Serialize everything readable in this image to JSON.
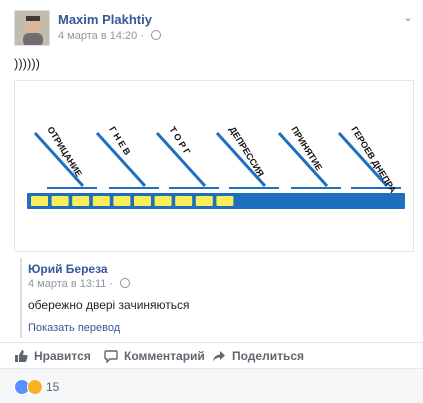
{
  "post": {
    "author": "Maxim Plakhtiy",
    "date": "4 марта в 14:20 · ",
    "text": "))))))"
  },
  "image": {
    "labels": [
      "ОТРИЦАНИЕ",
      "Г Н Е В",
      "Т О Р Г",
      "ДЕПРЕССИЯ",
      "ПРИНЯТИЕ",
      "ГЕРОЕВ ДНЕПРА"
    ],
    "progress_filled": 10,
    "progress_total": 17,
    "colors": {
      "bar": "#1e6fc0",
      "cell": "#fbee5a",
      "lines": "#1e6fc0"
    }
  },
  "shared": {
    "name": "Юрий Береза",
    "date": "4 марта в 13:11 · ",
    "text": "обережно двері зачиняються",
    "translate": "Показать перевод"
  },
  "actions": {
    "like": "Нравится",
    "comment": "Комментарий",
    "share": "Поделиться"
  },
  "reactions": {
    "count": "15"
  },
  "colors": {
    "link": "#365899",
    "muted": "#90949c"
  }
}
